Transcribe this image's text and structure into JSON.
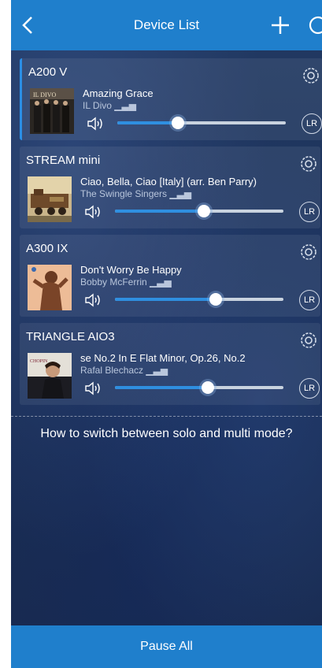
{
  "header": {
    "title": "Device List"
  },
  "devices": [
    {
      "name": "A200 V",
      "song": "Amazing Grace",
      "artist": "IL Divo",
      "volume": 0.36,
      "lr": "LR",
      "cover": "il-divo-cover"
    },
    {
      "name": "STREAM mini",
      "song": "Ciao, Bella, Ciao [Italy] (arr. Ben Parry)",
      "artist": "The Swingle Singers",
      "volume": 0.53,
      "lr": "LR",
      "cover": "train-cover"
    },
    {
      "name": "A300 IX",
      "song": "Don't Worry Be Happy",
      "artist": "Bobby McFerrin",
      "volume": 0.6,
      "lr": "LR",
      "cover": "mcferrin-cover"
    },
    {
      "name": "TRIANGLE AIO3",
      "song": "se No.2 In E Flat Minor, Op.26, No.2",
      "artist": "Rafal Blechacz",
      "volume": 0.55,
      "lr": "LR",
      "cover": "chopin-cover"
    }
  ],
  "help": {
    "text": "How to switch between solo and multi mode?"
  },
  "footer": {
    "pause_all": "Pause All"
  },
  "colors": {
    "accent": "#1f7fcc",
    "slider_fill": "#2f8fe0"
  }
}
